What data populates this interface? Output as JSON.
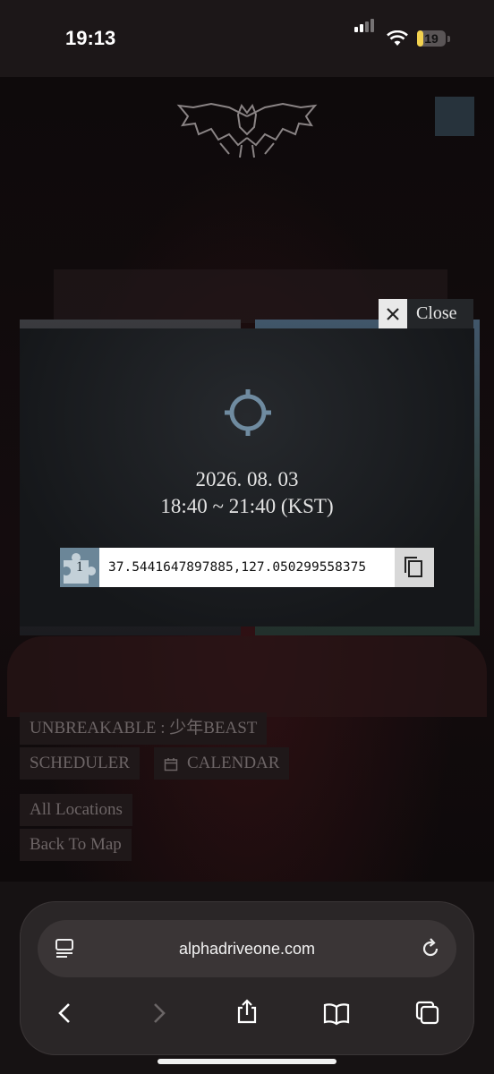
{
  "status": {
    "time": "19:13",
    "battery": "19"
  },
  "brand": {
    "puzzle_count": "1"
  },
  "modal": {
    "close_label": "Close",
    "date": "2026. 08. 03",
    "time_range": "18:40 ~ 21:40 (KST)",
    "badge_number": "1",
    "coordinates": "37.5441647897885,127.050299558375"
  },
  "menu": {
    "title": "UNBREAKABLE : 少年BEAST",
    "scheduler": "SCHEDULER",
    "calendar": "CALENDAR",
    "all_locations": "All Locations",
    "back_to_map": "Back To Map"
  },
  "browser": {
    "url": "alphadriveone.com"
  },
  "colors": {
    "accent": "#6b8698",
    "target": "#6f8ba0",
    "background": "#120d0e"
  }
}
